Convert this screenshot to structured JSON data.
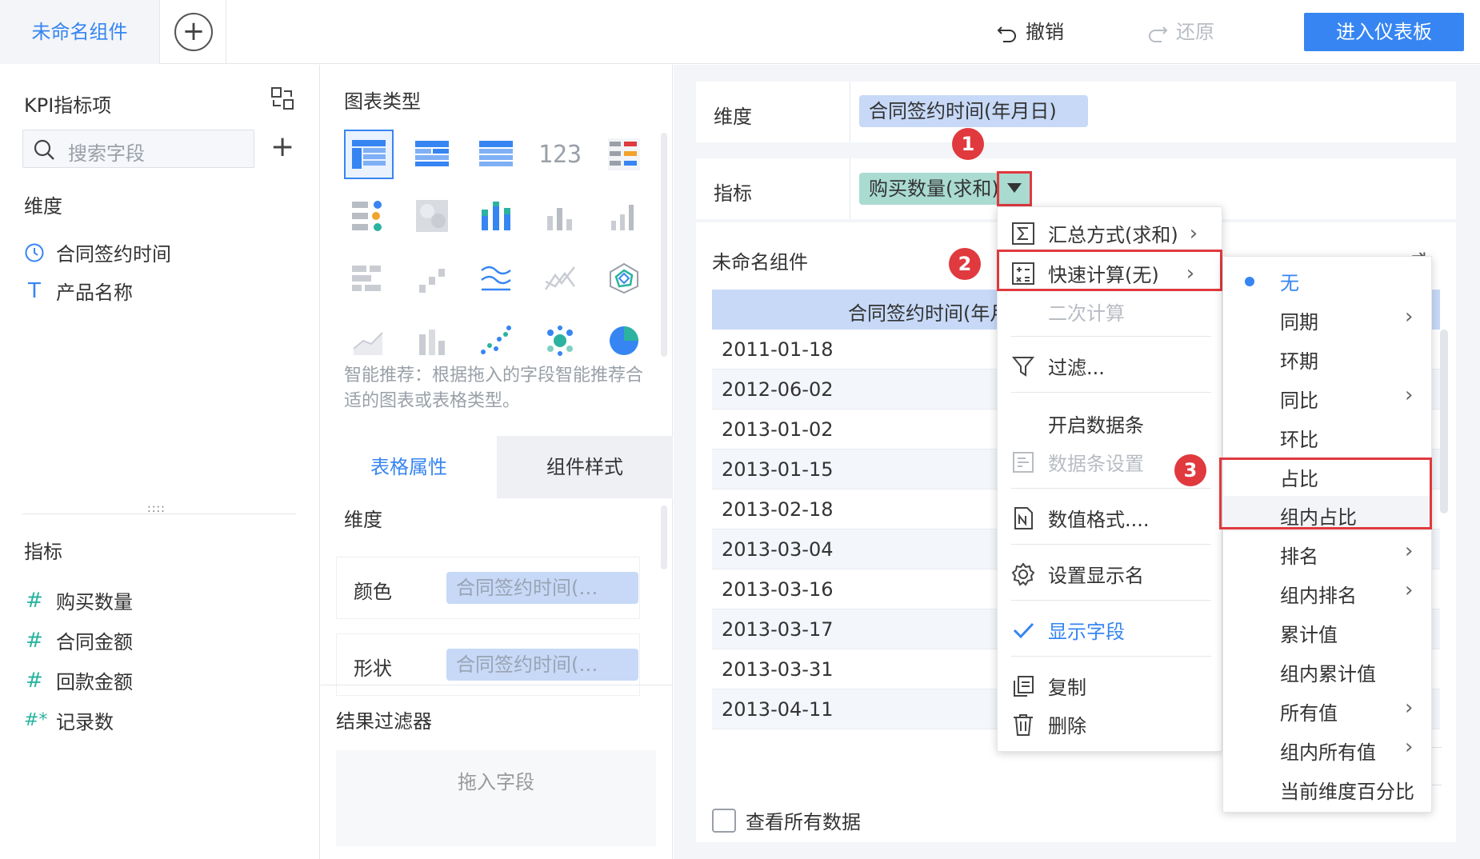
{
  "topbar": {
    "active_tab": "未命名组件",
    "add_tab_symbol": "+",
    "undo_label": "撤销",
    "redo_label": "还原",
    "enter_dashboard_label": "进入仪表板"
  },
  "left": {
    "title": "KPI指标项",
    "search_placeholder": "搜索字段",
    "add_symbol": "+",
    "dimension_title": "维度",
    "dimensions": [
      {
        "label": "合同签约时间",
        "icon": "clock-icon"
      },
      {
        "label": "产品名称",
        "icon": "text-type-icon"
      }
    ],
    "splitter_symbol": "::::",
    "metric_title": "指标",
    "metrics": [
      {
        "label": "购买数量",
        "icon": "#"
      },
      {
        "label": "合同金额",
        "icon": "#"
      },
      {
        "label": "回款金额",
        "icon": "#"
      },
      {
        "label": "记录数",
        "icon": "#*"
      }
    ]
  },
  "middle": {
    "chart_type_title": "图表类型",
    "recommend_text": "智能推荐：根据拖入的字段智能推荐合适的图表或表格类型。",
    "tab_table_props": "表格属性",
    "tab_component_style": "组件样式",
    "dimension_label": "维度",
    "color_label": "颜色",
    "color_value": "合同签约时间(…",
    "shape_label": "形状",
    "shape_value": "合同签约时间(…",
    "result_filter_title": "结果过滤器",
    "drop_field": "拖入字段",
    "grip_symbol": "⋮⋮"
  },
  "shelves": {
    "dimension_label": "维度",
    "dimension_pill": "合同签约时间(年月日)",
    "metric_label": "指标",
    "metric_pill": "购买数量(求和)"
  },
  "widget": {
    "title": "未命名组件",
    "column_header": "合同签约时间(年月",
    "rows": [
      "2011-01-18",
      "2012-06-02",
      "2013-01-02",
      "2013-01-15",
      "2013-02-18",
      "2013-03-04",
      "2013-03-16",
      "2013-03-17",
      "2013-03-31",
      "2013-04-11"
    ],
    "view_all": "查看所有数据"
  },
  "menu": {
    "summary": "汇总方式(求和)",
    "quick_calc": "快速计算(无)",
    "secondary_calc": "二次计算",
    "filter": "过滤...",
    "enable_databar": "开启数据条",
    "databar_settings": "数据条设置",
    "number_format": "数值格式....",
    "set_display_name": "设置显示名",
    "show_field": "显示字段",
    "copy": "复制",
    "delete": "删除"
  },
  "submenu": {
    "items": [
      {
        "label": "无",
        "selected": true,
        "arrow": false
      },
      {
        "label": "同期",
        "selected": false,
        "arrow": true
      },
      {
        "label": "环期",
        "selected": false,
        "arrow": false
      },
      {
        "label": "同比",
        "selected": false,
        "arrow": true
      },
      {
        "label": "环比",
        "selected": false,
        "arrow": false
      },
      {
        "label": "占比",
        "selected": false,
        "arrow": false
      },
      {
        "label": "组内占比",
        "selected": false,
        "arrow": false
      },
      {
        "label": "排名",
        "selected": false,
        "arrow": true
      },
      {
        "label": "组内排名",
        "selected": false,
        "arrow": true
      },
      {
        "label": "累计值",
        "selected": false,
        "arrow": false
      },
      {
        "label": "组内累计值",
        "selected": false,
        "arrow": false
      },
      {
        "label": "所有值",
        "selected": false,
        "arrow": true
      },
      {
        "label": "组内所有值",
        "selected": false,
        "arrow": true
      },
      {
        "label": "当前维度百分比",
        "selected": false,
        "arrow": false
      }
    ]
  },
  "badges": [
    "1",
    "2",
    "3"
  ],
  "colors": {
    "accent": "#3685f2",
    "highlight_red": "#e0393e",
    "dimension_pill": "#c7d9f7",
    "metric_pill": "#a9dbd1",
    "metric_icon": "#2bb3a0"
  }
}
